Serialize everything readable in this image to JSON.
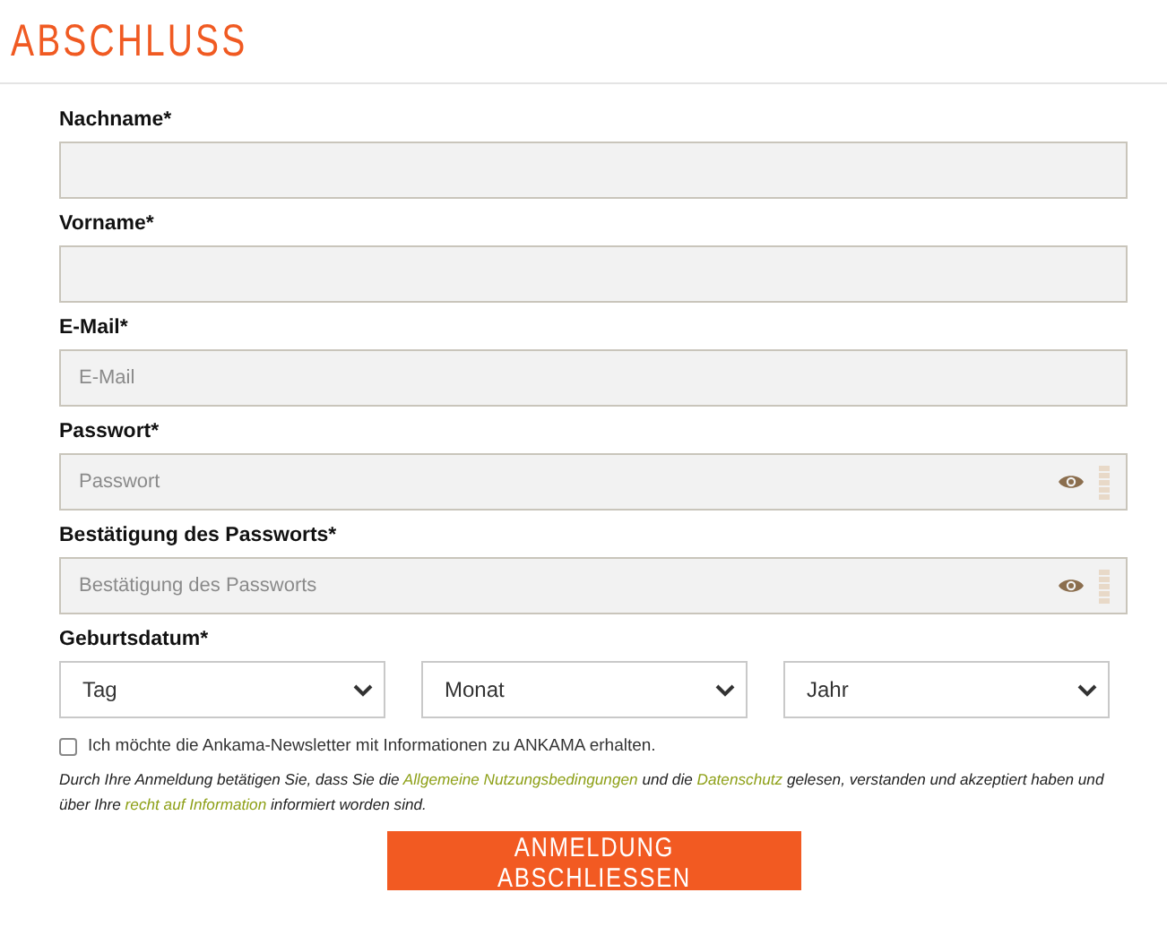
{
  "title": "ABSCHLUSS",
  "fields": [
    {
      "label": "Nachname*",
      "kind": "text"
    },
    {
      "label": "Vorname*",
      "kind": "text"
    },
    {
      "label": "E-Mail*",
      "kind": "text",
      "placeholder": "E-Mail"
    },
    {
      "label": "Passwort*",
      "kind": "password",
      "placeholder": "Passwort"
    },
    {
      "label": "Bestätigung des Passworts*",
      "kind": "password",
      "placeholder": "Bestätigung des Passworts"
    }
  ],
  "birthdate": {
    "label": "Geburtsdatum*",
    "selects": [
      "Tag",
      "Monat",
      "Jahr"
    ]
  },
  "newsletter": {
    "label": "Ich möchte die Ankama-Newsletter mit Informationen zu ANKAMA erhalten.",
    "checked": false
  },
  "legal": [
    {
      "kind": "text",
      "text": "Durch Ihre Anmeldung betätigen Sie, dass Sie die "
    },
    {
      "kind": "link",
      "text": "Allgemeine Nutzungsbedingungen"
    },
    {
      "kind": "text",
      "text": " und die "
    },
    {
      "kind": "link",
      "text": "Datenschutz"
    },
    {
      "kind": "text",
      "text": " gelesen, verstanden und akzeptiert haben und über Ihre "
    },
    {
      "kind": "link",
      "text": "recht auf Information"
    },
    {
      "kind": "text",
      "text": " informiert worden sind."
    }
  ],
  "submit": "ANMELDUNG ABSCHLIESSEN"
}
